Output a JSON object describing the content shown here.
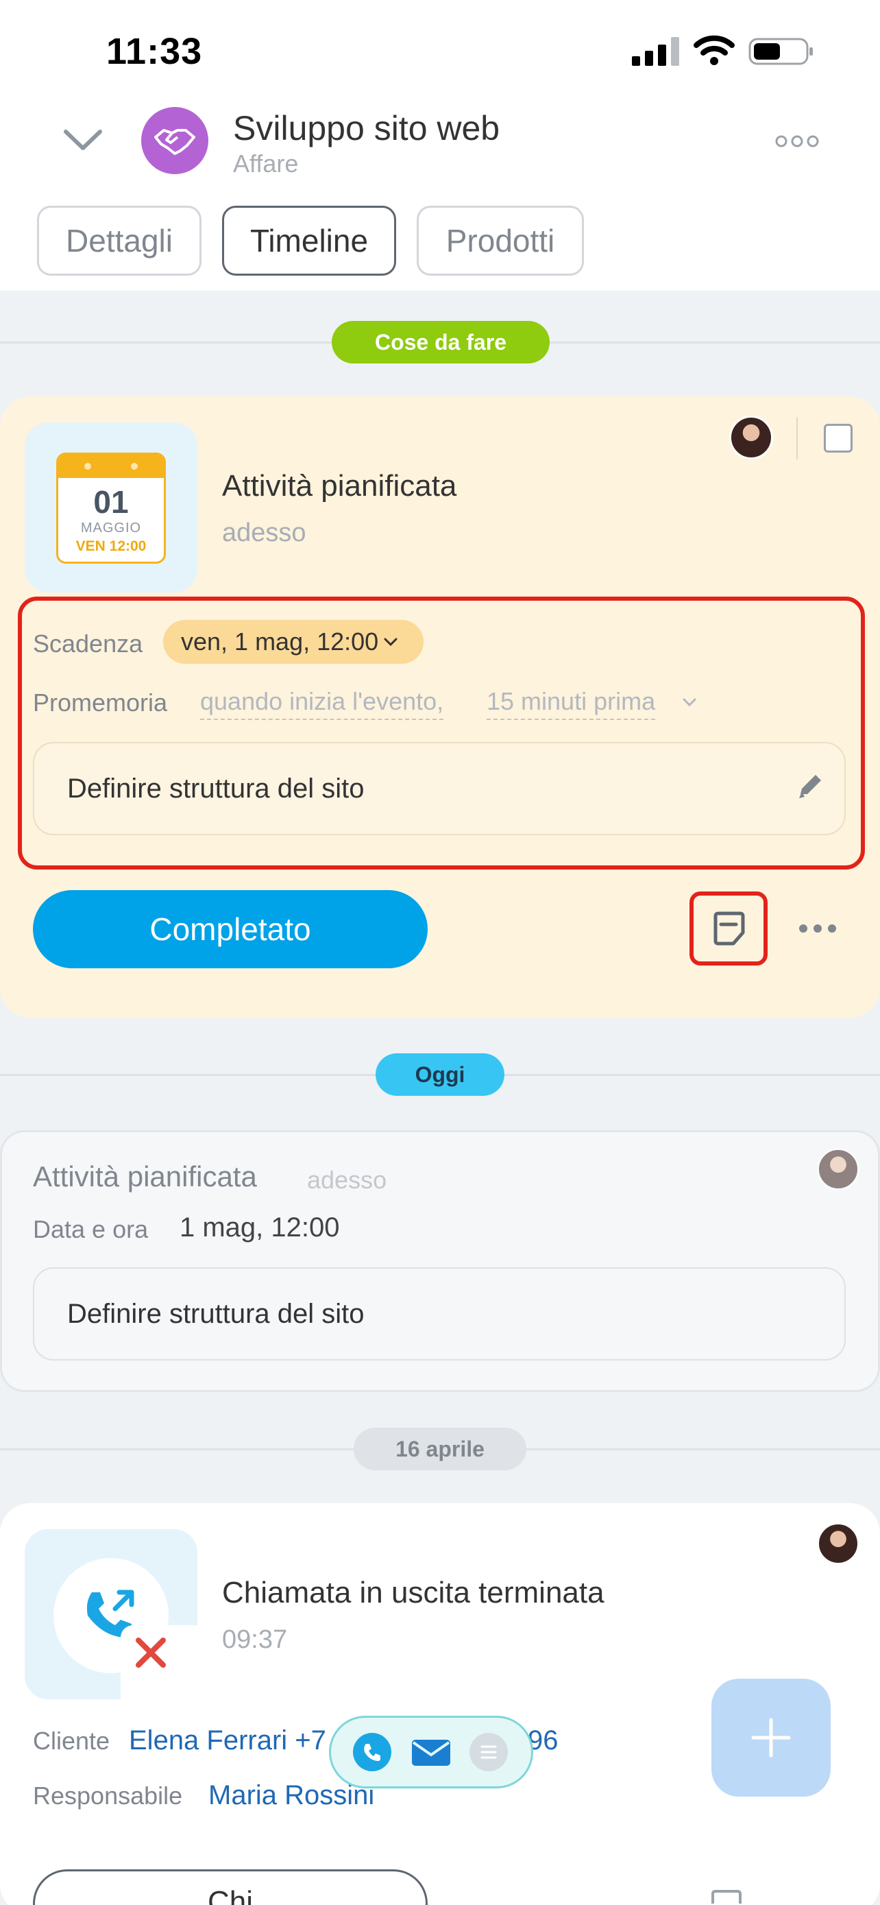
{
  "status_bar": {
    "time": "11:33"
  },
  "header": {
    "title": "Sviluppo sito web",
    "subtitle": "Affare"
  },
  "tabs": [
    {
      "label": "Dettagli",
      "active": false
    },
    {
      "label": "Timeline",
      "active": true
    },
    {
      "label": "Prodotti",
      "active": false
    }
  ],
  "todo_section": {
    "badge": "Cose da fare",
    "badge_color": "#8fcb0e"
  },
  "todo": {
    "calendar": {
      "day": "01",
      "month": "MAGGIO",
      "time": "VEN 12:00"
    },
    "title": "Attività pianificata",
    "subtitle": "adesso",
    "deadline_label": "Scadenza",
    "deadline_value": "ven, 1 mag, 12:00",
    "reminder_label": "Promemoria",
    "reminder_value_1": "quando inizia l'evento,",
    "reminder_value_2": "15 minuti prima",
    "description": "Definire struttura del sito",
    "complete_button": "Completato"
  },
  "today_section": {
    "badge": "Oggi",
    "badge_color": "#37c6f4"
  },
  "history_item": {
    "title": "Attività pianificata",
    "when": "adesso",
    "datetime_label": "Data e ora",
    "datetime_value": "1 mag, 12:00",
    "description": "Definire struttura del sito"
  },
  "april_section": {
    "badge": "16 aprile"
  },
  "call_item": {
    "title": "Chiamata in uscita terminata",
    "time": "09:37",
    "client_label": "Cliente",
    "client_value": "Elena Ferrari +7",
    "client_value_tail": "96",
    "responsible_label": "Responsabile",
    "responsible_value": "Maria Rossini",
    "bottom_button_partial": "Chi"
  },
  "colors": {
    "accent_blue": "#00a2e8",
    "highlight_red": "#e2231a",
    "deal_purple": "#b463d4"
  }
}
